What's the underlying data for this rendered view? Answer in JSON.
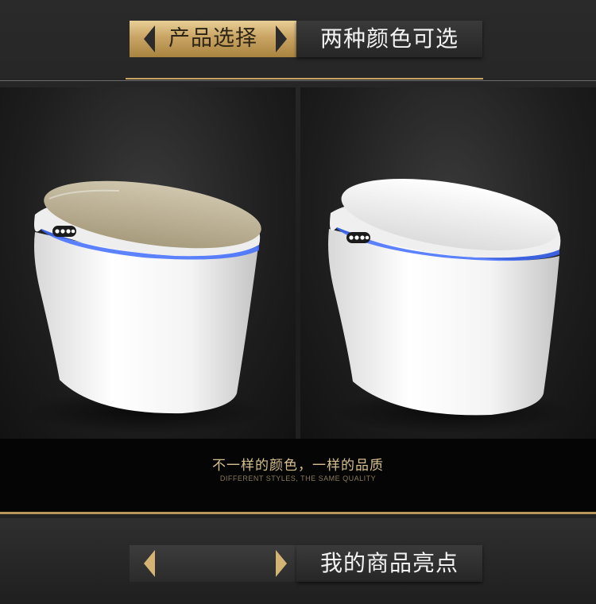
{
  "top_banner": {
    "left_label": "产品选择",
    "right_label": "两种颜色可选"
  },
  "products": [
    {
      "name": "toilet-gold-lid",
      "lid_color": "#bfb49a",
      "buttons": 4
    },
    {
      "name": "toilet-white-lid",
      "lid_color": "#f2f2f2",
      "buttons": 4
    }
  ],
  "caption": {
    "cn": "不一样的颜色，一样的品质",
    "en": "DIFFERENT STYLES, THE SAME QUALITY"
  },
  "bottom_banner": {
    "left_label": "",
    "right_label": "我的商品亮点"
  },
  "colors": {
    "gold": "#c9a464",
    "background": "#1d1d1d",
    "led": "#3f6cff"
  }
}
